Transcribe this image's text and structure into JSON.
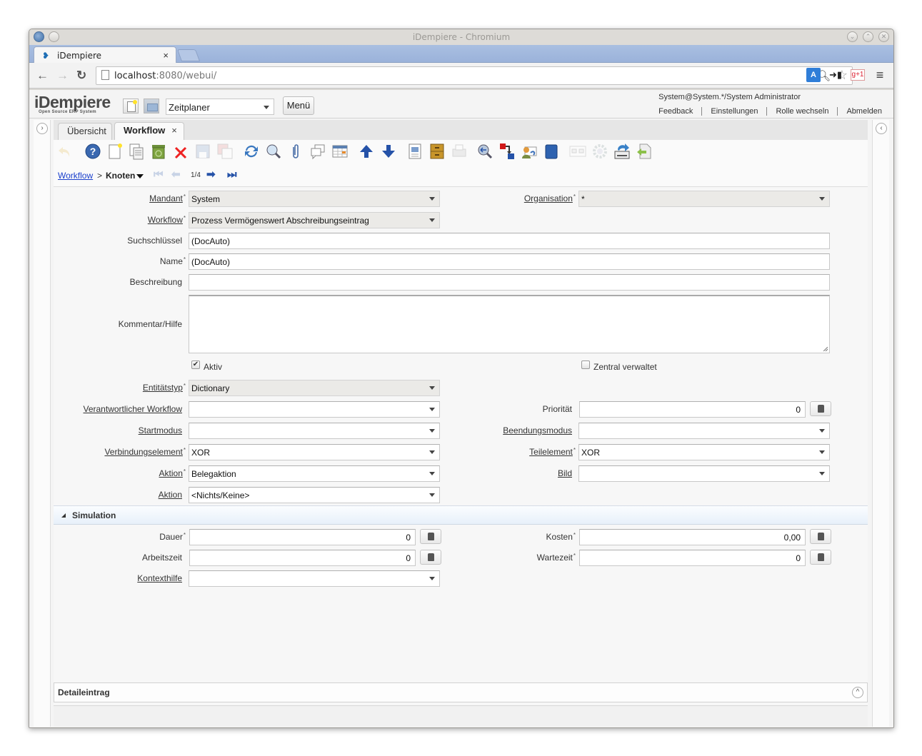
{
  "browser": {
    "window_title": "iDempiere - Chromium",
    "tab_title": "iDempiere",
    "url_host": "localhost",
    "url_rest": ":8080/webui/"
  },
  "app": {
    "logo": "iDempiere",
    "logo_sub": "Open Source ERP System",
    "menu_select": "Zeitplaner",
    "menu_button": "Menü",
    "user": "System@System.*/System Administrator",
    "links": [
      "Feedback",
      "Einstellungen",
      "Rolle wechseln",
      "Abmelden"
    ]
  },
  "window_tabs": {
    "overview": "Übersicht",
    "active": "Workflow"
  },
  "breadcrumb": {
    "parent": "Workflow",
    "separator": ">",
    "current": "Knoten",
    "record_count": "1/4"
  },
  "form": {
    "mandant": {
      "label": "Mandant",
      "value": "System"
    },
    "organisation": {
      "label": "Organisation",
      "value": "*"
    },
    "workflow": {
      "label": "Workflow",
      "value": "Prozess Vermögenswert Abschreibungseintrag"
    },
    "suchschluessel": {
      "label": "Suchschlüssel",
      "value": "(DocAuto)"
    },
    "name": {
      "label": "Name",
      "value": "(DocAuto)"
    },
    "beschreibung": {
      "label": "Beschreibung",
      "value": ""
    },
    "kommentar": {
      "label": "Kommentar/Hilfe",
      "value": ""
    },
    "aktiv": {
      "label": "Aktiv",
      "checked": true,
      "mark": "✔"
    },
    "zentral": {
      "label": "Zentral verwaltet",
      "checked": false
    },
    "entitaetstyp": {
      "label": "Entitätstyp",
      "value": "Dictionary"
    },
    "verantwortlicher": {
      "label": "Verantwortlicher Workflow",
      "value": ""
    },
    "prioritaet": {
      "label": "Priorität",
      "value": "0"
    },
    "startmodus": {
      "label": "Startmodus",
      "value": ""
    },
    "beendungsmodus": {
      "label": "Beendungsmodus",
      "value": ""
    },
    "verbindungselement": {
      "label": "Verbindungselement",
      "value": "XOR"
    },
    "teilelement": {
      "label": "Teilelement",
      "value": "XOR"
    },
    "aktion1": {
      "label": "Aktion",
      "value": "Belegaktion"
    },
    "bild": {
      "label": "Bild",
      "value": ""
    },
    "aktion2": {
      "label": "Aktion",
      "value": "<Nichts/Keine>"
    }
  },
  "simulation": {
    "title": "Simulation",
    "dauer": {
      "label": "Dauer",
      "value": "0"
    },
    "kosten": {
      "label": "Kosten",
      "value": "0,00"
    },
    "arbeitszeit": {
      "label": "Arbeitszeit",
      "value": "0"
    },
    "wartezeit": {
      "label": "Wartezeit",
      "value": "0"
    },
    "kontexthilfe": {
      "label": "Kontexthilfe",
      "value": ""
    }
  },
  "detail": {
    "title": "Detaileintrag"
  },
  "required_mark": "*"
}
